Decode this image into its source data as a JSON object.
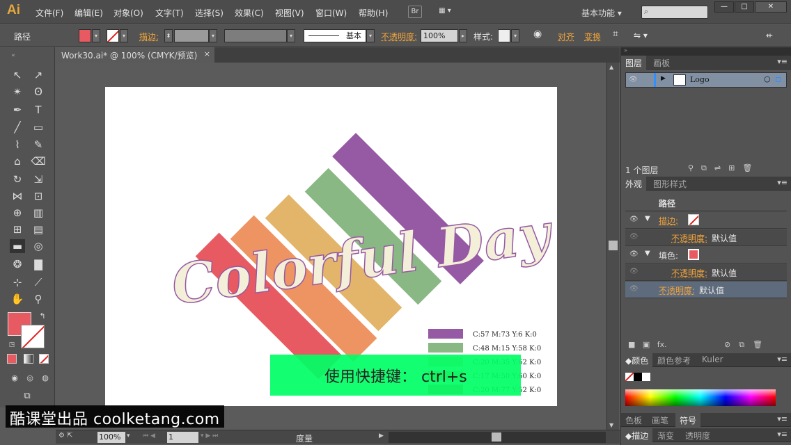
{
  "app": {
    "logo": "Ai"
  },
  "menus": [
    "文件(F)",
    "编辑(E)",
    "对象(O)",
    "文字(T)",
    "选择(S)",
    "效果(C)",
    "视图(V)",
    "窗口(W)",
    "帮助(H)"
  ],
  "menubar": {
    "bridge": "Br",
    "workspace": "基本功能 ▾",
    "minimize": "—",
    "maximize": "□",
    "close": "✕"
  },
  "control": {
    "object_type": "路径",
    "stroke_label": "描边:",
    "stroke_style": "基本",
    "opacity_label": "不透明度:",
    "opacity_value": "100%",
    "style_label": "样式:",
    "align_label": "对齐",
    "transform_label": "变换",
    "colors": {
      "fill": "#e85a62"
    }
  },
  "document": {
    "tab_title": "Work30.ai* @ 100% (CMYK/预览)",
    "close": "×"
  },
  "artwork": {
    "title_text": "Colorful Day",
    "stripes": [
      {
        "color": "#e85a62"
      },
      {
        "color": "#ee9462"
      },
      {
        "color": "#e2b56a"
      },
      {
        "color": "#8ab884"
      },
      {
        "color": "#9659a3"
      }
    ],
    "legend": [
      {
        "color": "#9659a3",
        "label": "C:57 M:73 Y:6 K:0"
      },
      {
        "color": "#8ab884",
        "label": "C:48 M:15 Y:58 K:0"
      },
      {
        "color": "#e2b56a",
        "label": "C:20 M:35 Y:62 K:0"
      },
      {
        "color": "#ee9462",
        "label": "C:17 M:50 Y:60 K:0"
      },
      {
        "color": "#e85a62",
        "label": "C:20 M:77 Y:52 K:0"
      }
    ]
  },
  "overlay": {
    "shortcut_text": "使用快捷键：  ctrl+s",
    "color": "#00ff66"
  },
  "statusbar": {
    "zoom": "100%",
    "page": "1",
    "info": "度量"
  },
  "layers_panel": {
    "tabs": [
      "图层",
      "画板"
    ],
    "layer_name": "Logo",
    "layer_count": "1 个图层"
  },
  "appearance_panel": {
    "tabs": [
      "外观",
      "图形样式"
    ],
    "title": "路径",
    "stroke_label": "描边:",
    "fill_label": "填色:",
    "opacity_label": "不透明度:",
    "default_value": "默认值",
    "fx": "fx."
  },
  "color_panel": {
    "tabs": [
      "颜色",
      "颜色参考",
      "Kuler"
    ]
  },
  "brush_panel": {
    "tabs": [
      "色板",
      "画笔",
      "符号"
    ]
  },
  "stroke_panel": {
    "tabs": [
      "描边",
      "渐变",
      "透明度"
    ]
  },
  "watermark": "酷课堂出品 coolketang.com"
}
